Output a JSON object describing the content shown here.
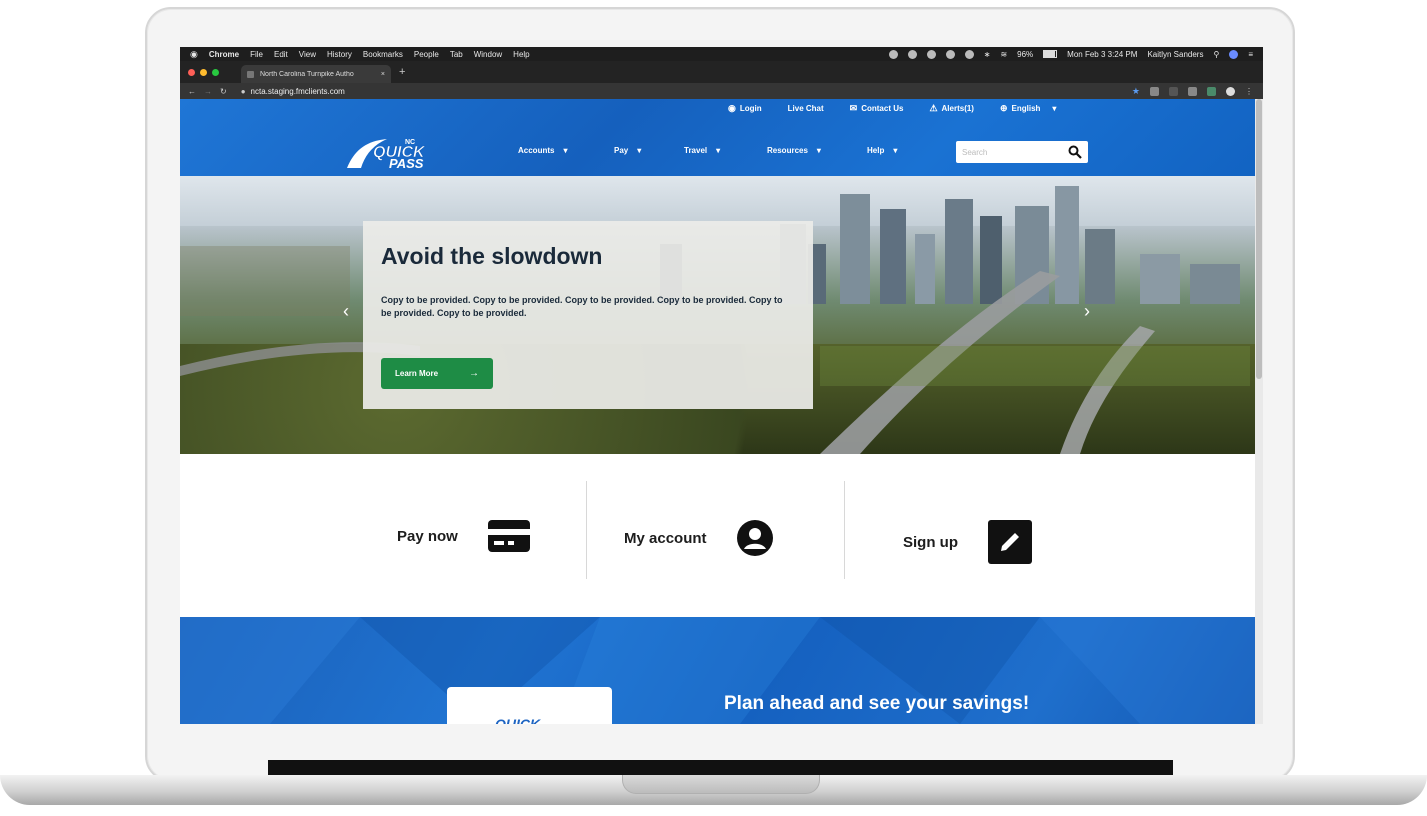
{
  "menubar": {
    "apple": "",
    "items": [
      "Chrome",
      "File",
      "Edit",
      "View",
      "History",
      "Bookmarks",
      "People",
      "Tab",
      "Window",
      "Help"
    ],
    "battery": "96%",
    "datetime": "Mon Feb 3  3:24 PM",
    "user": "Kaitlyn Sanders"
  },
  "browser": {
    "tab_title": "North Carolina Turnpike Autho",
    "tab_close": "×",
    "new_tab": "+",
    "url": "ncta.staging.fmclients.com"
  },
  "utility_nav": {
    "login": "Login",
    "live_chat": "Live Chat",
    "contact": "Contact Us",
    "alerts": "Alerts(1)",
    "language": "English"
  },
  "logo": {
    "top": "NC",
    "line1": "QUICK",
    "line2": "PASS"
  },
  "main_nav": [
    "Accounts",
    "Pay",
    "Travel",
    "Resources",
    "Help"
  ],
  "search": {
    "placeholder": "Search"
  },
  "hero": {
    "title": "Avoid the slowdown",
    "body": "Copy to be provided. Copy to be provided. Copy to be provided. Copy to be provided. Copy to be provided. Copy to be provided.",
    "cta": "Learn More"
  },
  "quick_links": {
    "pay": "Pay now",
    "account": "My account",
    "signup": "Sign up"
  },
  "promo": {
    "title": "Plan ahead and see your savings!",
    "logo": "QUICK"
  },
  "colors": {
    "brand_blue": "#1a6fcf",
    "cta_green": "#1e8c45"
  }
}
